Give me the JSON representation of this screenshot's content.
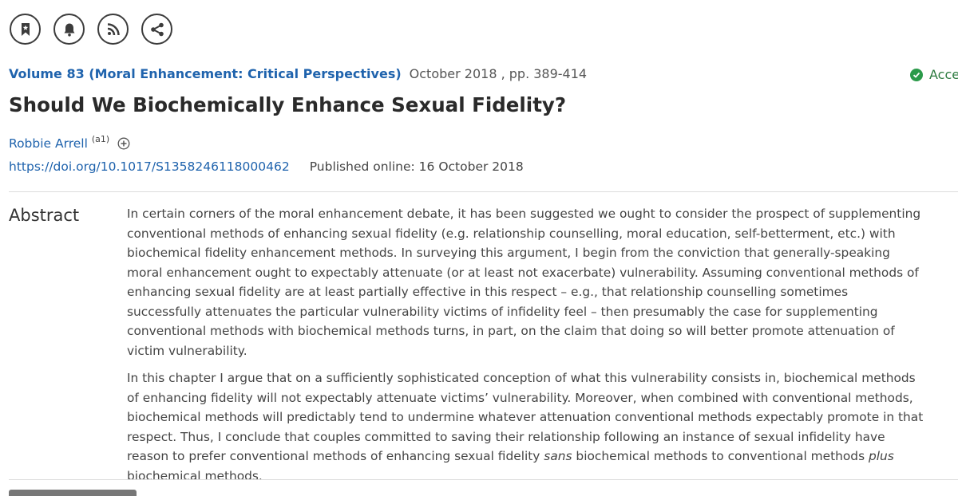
{
  "actions": [
    {
      "icon": "bookmark-icon"
    },
    {
      "icon": "bell-icon"
    },
    {
      "icon": "rss-icon"
    },
    {
      "icon": "share-icon"
    }
  ],
  "meta": {
    "volume": "Volume 83 (Moral Enhancement: Critical Perspectives)",
    "date_pages": "October 2018 , pp. 389-414",
    "access": "Acces"
  },
  "title": "Should We Biochemically Enhance Sexual Fidelity?",
  "author": {
    "name": "Robbie Arrell",
    "affiliation": "(a1)"
  },
  "doi": "https://doi.org/10.1017/S1358246118000462",
  "published": "Published online: 16 October 2018",
  "abstract": {
    "heading": "Abstract",
    "p1": "In certain corners of the moral enhancement debate, it has been suggested we ought to consider the prospect of supplementing conventional methods of enhancing sexual fidelity (e.g. relationship counselling, moral education, self-betterment, etc.) with biochemical fidelity enhancement methods. In surveying this argument, I begin from the conviction that generally-speaking moral enhancement ought to expectably attenuate (or at least not exacerbate) vulnerability. Assuming conventional methods of enhancing sexual fidelity are at least partially effective in this respect – e.g., that relationship counselling sometimes successfully attenuates the particular vulnerability victims of infidelity feel – then presumably the case for supplementing conventional methods with biochemical methods turns, in part, on the claim that doing so will better promote attenuation of victim vulnerability.",
    "p2_a": "In this chapter I argue that on a sufficiently sophisticated conception of what this vulnerability consists in, biochemical methods of enhancing fidelity will not expectably attenuate victims’ vulnerability. Moreover, when combined with conventional methods, biochemical methods will predictably tend to undermine whatever attenuation conventional methods expectably promote in that respect. Thus, I conclude that couples committed to saving their relationship following an instance of sexual infidelity have reason to prefer conventional methods of enhancing sexual fidelity ",
    "p2_em1": "sans",
    "p2_b": " biochemical methods to conventional methods ",
    "p2_em2": "plus",
    "p2_c": " biochemical methods."
  },
  "colors": {
    "link": "#1f63ad",
    "access": "#2b9a4a",
    "icon": "#3c3c3c"
  }
}
